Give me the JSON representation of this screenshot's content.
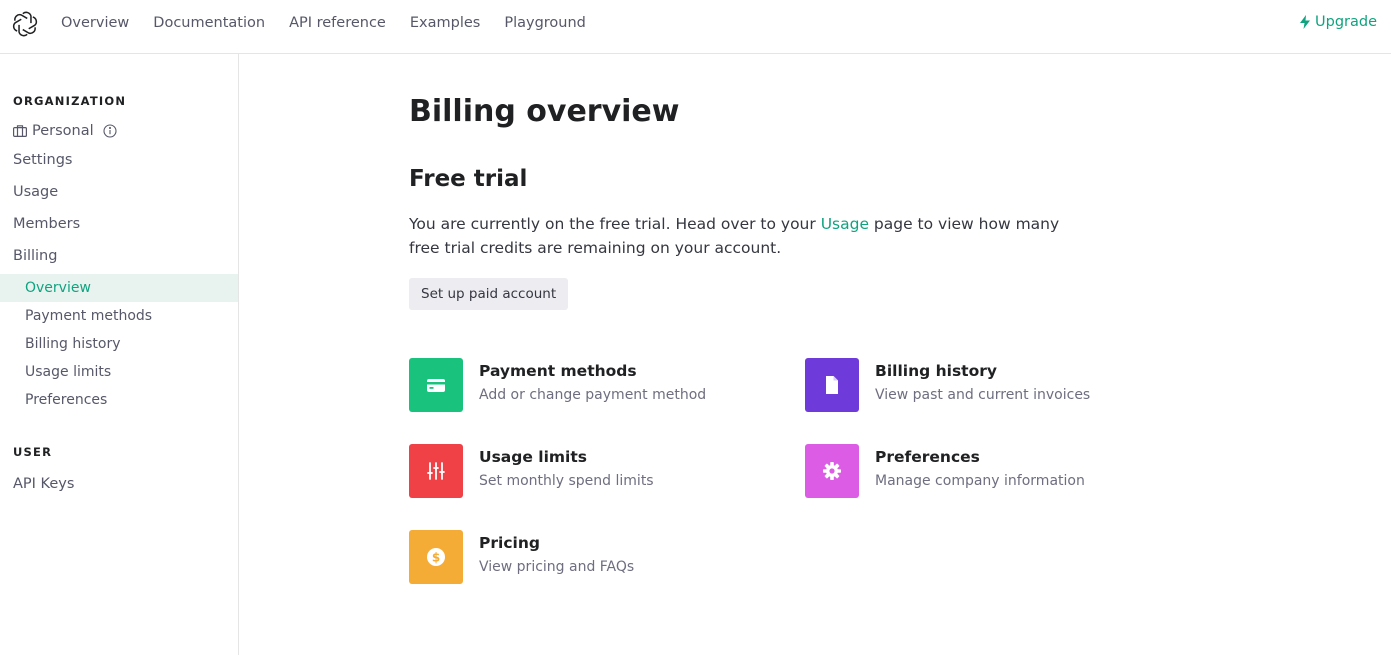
{
  "nav": {
    "links": [
      "Overview",
      "Documentation",
      "API reference",
      "Examples",
      "Playground"
    ],
    "upgrade": "Upgrade"
  },
  "sidebar": {
    "org_heading": "ORGANIZATION",
    "personal": "Personal",
    "items": [
      "Settings",
      "Usage",
      "Members",
      "Billing"
    ],
    "billing_sub": [
      "Overview",
      "Payment methods",
      "Billing history",
      "Usage limits",
      "Preferences"
    ],
    "user_heading": "USER",
    "api_keys": "API Keys"
  },
  "main": {
    "title": "Billing overview",
    "subtitle": "Free trial",
    "para_before": "You are currently on the free trial. Head over to your ",
    "para_link": "Usage",
    "para_after": " page to view how many free trial credits are remaining on your account.",
    "button": "Set up paid account",
    "cards": [
      {
        "title": "Payment methods",
        "desc": "Add or change payment method",
        "color": "#19c37d",
        "icon": "credit-card-icon"
      },
      {
        "title": "Billing history",
        "desc": "View past and current invoices",
        "color": "#6e3ad9",
        "icon": "document-icon"
      },
      {
        "title": "Usage limits",
        "desc": "Set monthly spend limits",
        "color": "#ef4146",
        "icon": "sliders-icon"
      },
      {
        "title": "Preferences",
        "desc": "Manage company information",
        "color": "#dd5ce5",
        "icon": "gear-icon"
      },
      {
        "title": "Pricing",
        "desc": "View pricing and FAQs",
        "color": "#f4ac36",
        "icon": "dollar-icon"
      }
    ]
  },
  "colors": {
    "accent": "#10a37f",
    "active_bg": "#e8f3f0"
  }
}
